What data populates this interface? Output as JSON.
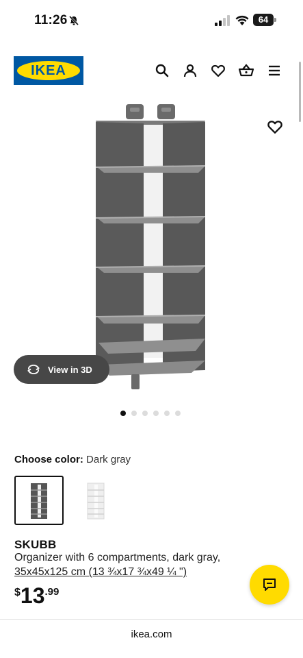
{
  "status_bar": {
    "time": "11:26",
    "battery": "64"
  },
  "header": {
    "logo_text": "IKEA"
  },
  "gallery": {
    "view_3d_label": "View in 3D",
    "slide_count": 6,
    "active_slide": 0
  },
  "color": {
    "label": "Choose color:",
    "value": "Dark gray"
  },
  "product": {
    "name": "SKUBB",
    "description": "Organizer with 6 compartments, dark gray,",
    "dimensions": "35x45x125 cm (13 ¾x17 ¾x49 ¼ \")",
    "price": {
      "currency": "$",
      "integer": "13",
      "decimal": ".99"
    }
  },
  "browser": {
    "url": "ikea.com"
  },
  "colors": {
    "ikea_blue": "#0058a3",
    "ikea_yellow": "#ffdb00",
    "product_gray": "#555555"
  }
}
